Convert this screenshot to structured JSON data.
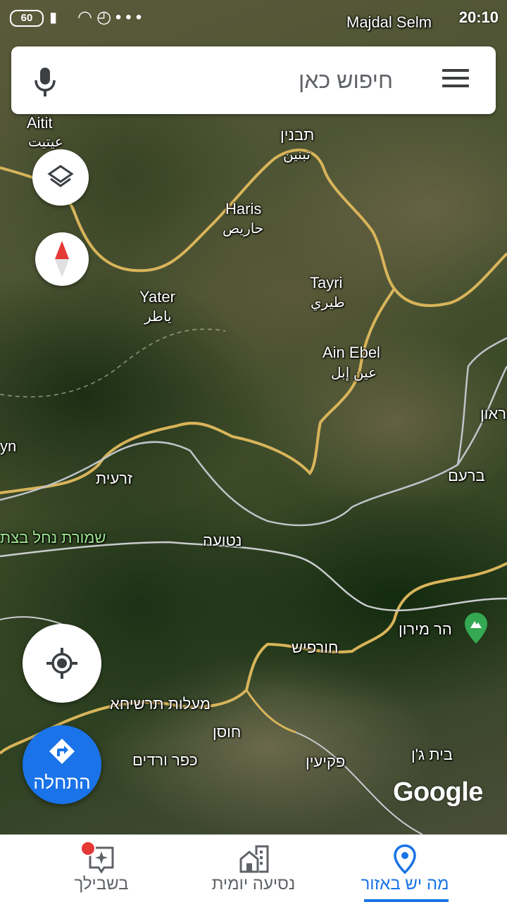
{
  "status_bar": {
    "battery": "60",
    "time": "20:10"
  },
  "search": {
    "placeholder": "חיפוש כאן",
    "mic_icon": "mic-icon",
    "menu_icon": "menu-icon"
  },
  "map": {
    "labels": [
      {
        "id": "aitit",
        "text": "Aitit"
      },
      {
        "id": "aitit_ar",
        "text": "عيتيت"
      },
      {
        "id": "majdal",
        "text": "Majdal Selm"
      },
      {
        "id": "tibnin",
        "text": "תבנין"
      },
      {
        "id": "tibnin_ar",
        "text": "تبنين"
      },
      {
        "id": "haris",
        "text": "Haris"
      },
      {
        "id": "haris_ar",
        "text": "حاريص"
      },
      {
        "id": "yater",
        "text": "Yater"
      },
      {
        "id": "yater_ar",
        "text": "ياطر"
      },
      {
        "id": "tayri",
        "text": "Tayri"
      },
      {
        "id": "tayri_ar",
        "text": "طيري"
      },
      {
        "id": "ainebel",
        "text": "Ain Ebel"
      },
      {
        "id": "ainebel_ar",
        "text": "عين إبل"
      },
      {
        "id": "zarit",
        "text": "זרעית"
      },
      {
        "id": "nahal",
        "text": "שמורת נחל בצת"
      },
      {
        "id": "netua",
        "text": "נטועה"
      },
      {
        "id": "baram",
        "text": "ברעם"
      },
      {
        "id": "meron",
        "text": "הר מירון"
      },
      {
        "id": "hurfeish",
        "text": "חורפיש"
      },
      {
        "id": "maalot",
        "text": "מעלות תרשיחא"
      },
      {
        "id": "hosen",
        "text": "חוסן"
      },
      {
        "id": "kfarvradim",
        "text": "כפר ורדים"
      },
      {
        "id": "pekiin",
        "text": "פקיעין"
      },
      {
        "id": "beitjann",
        "text": "בית ג'ן"
      },
      {
        "id": "saraaun",
        "text": "ראון"
      },
      {
        "id": "yn",
        "text": "yn"
      }
    ],
    "watermark": "Google"
  },
  "buttons": {
    "layers_icon": "layers-icon",
    "compass_icon": "compass-icon",
    "locate_icon": "my-location-icon",
    "go_label": "התחלה"
  },
  "bottom_nav": {
    "tabs": [
      {
        "label": "בשבילך",
        "icon": "sparkle-icon"
      },
      {
        "label": "נסיעה יומית",
        "icon": "commute-icon"
      },
      {
        "label": "מה יש באזור",
        "icon": "place-icon"
      }
    ],
    "active_index": 2,
    "accent": "#1a73e8"
  }
}
